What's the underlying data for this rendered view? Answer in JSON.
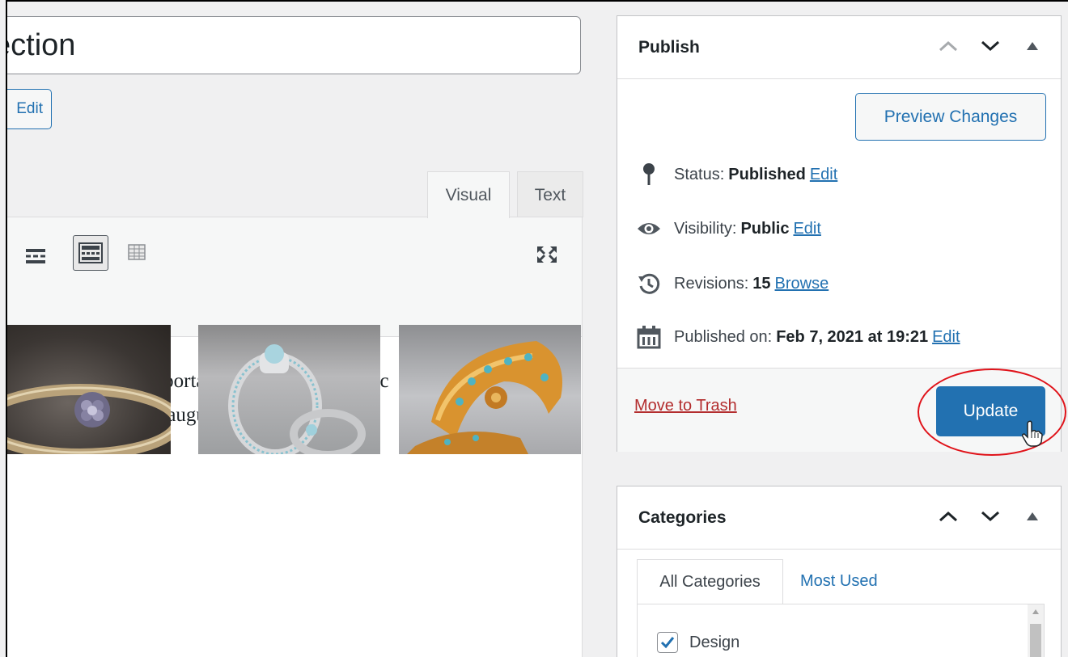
{
  "editor": {
    "title_value": "ection",
    "permalink_edit_label": "Edit",
    "tabs": {
      "visual": "Visual",
      "text": "Text"
    },
    "content_lines": [
      "Vestibulum viverra porta nunc a pulvinar. Nunc",
      "mi. Donec vehicula augue lorem, vel aliquam"
    ],
    "gallery": [
      {
        "icon": "ring-photo"
      },
      {
        "icon": "ring-set-photo"
      },
      {
        "icon": "bracelet-photo"
      }
    ]
  },
  "publish": {
    "title": "Publish",
    "preview_label": "Preview Changes",
    "status": {
      "label": "Status:",
      "value": "Published",
      "link": "Edit"
    },
    "visibility": {
      "label": "Visibility:",
      "value": "Public",
      "link": "Edit"
    },
    "revisions": {
      "label": "Revisions:",
      "value": "15",
      "link": "Browse"
    },
    "published_on": {
      "label": "Published on:",
      "value": "Feb 7, 2021 at 19:21",
      "link": "Edit"
    },
    "trash_label": "Move to Trash",
    "update_label": "Update"
  },
  "categories": {
    "title": "Categories",
    "tabs": {
      "all": "All Categories",
      "most_used": "Most Used"
    },
    "items": [
      {
        "label": "Design",
        "checked": true
      }
    ]
  },
  "colors": {
    "accent": "#2271b1",
    "trash": "#b32d2e",
    "highlight": "#e0131a"
  }
}
